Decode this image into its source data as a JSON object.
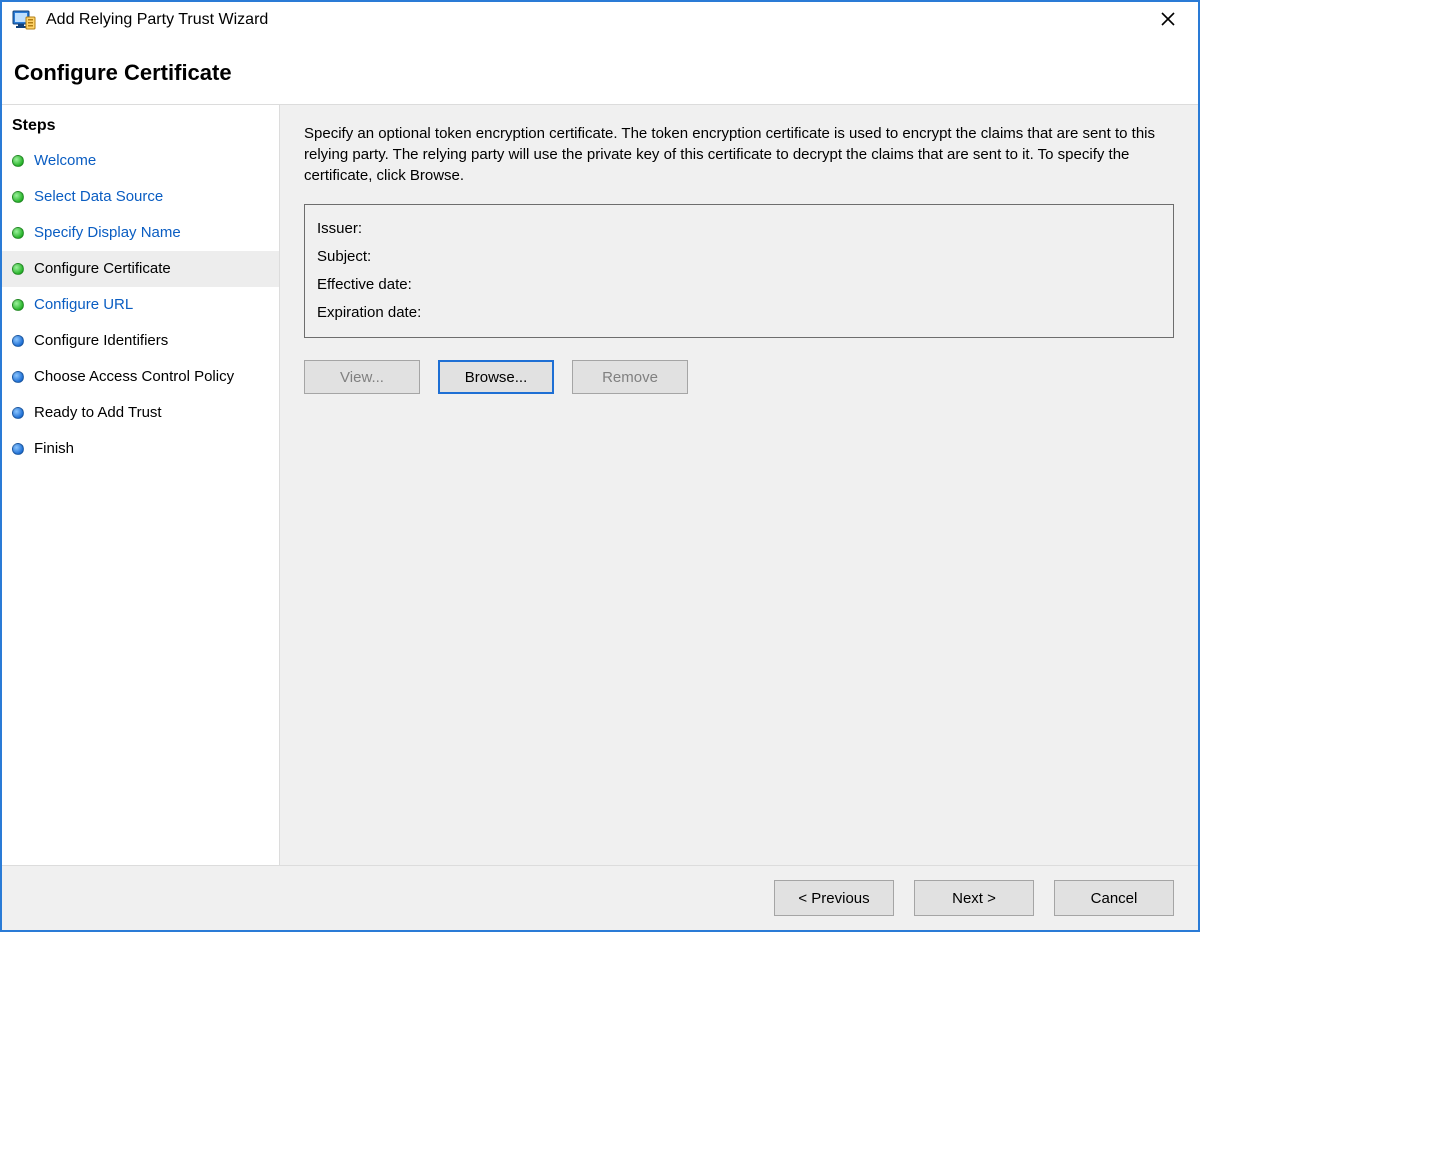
{
  "window": {
    "title": "Add Relying Party Trust Wizard"
  },
  "page": {
    "heading": "Configure Certificate"
  },
  "sidebar": {
    "header": "Steps",
    "items": [
      {
        "label": "Welcome",
        "status": "done",
        "style": "link"
      },
      {
        "label": "Select Data Source",
        "status": "done",
        "style": "link"
      },
      {
        "label": "Specify Display Name",
        "status": "done",
        "style": "link"
      },
      {
        "label": "Configure Certificate",
        "status": "done",
        "style": "current"
      },
      {
        "label": "Configure URL",
        "status": "done",
        "style": "link"
      },
      {
        "label": "Configure Identifiers",
        "status": "pending",
        "style": "plain"
      },
      {
        "label": "Choose Access Control Policy",
        "status": "pending",
        "style": "plain"
      },
      {
        "label": "Ready to Add Trust",
        "status": "pending",
        "style": "plain"
      },
      {
        "label": "Finish",
        "status": "pending",
        "style": "plain"
      }
    ]
  },
  "main": {
    "instructions": "Specify an optional token encryption certificate.  The token encryption certificate is used to encrypt the claims that are sent to this relying party.  The relying party will use the private key of this certificate to decrypt the claims that are sent to it.  To specify the certificate, click Browse.",
    "cert": {
      "issuer_label": "Issuer:",
      "issuer_value": "",
      "subject_label": "Subject:",
      "subject_value": "",
      "effective_label": "Effective date:",
      "effective_value": "",
      "expiration_label": "Expiration date:",
      "expiration_value": ""
    },
    "buttons": {
      "view": "View...",
      "browse": "Browse...",
      "remove": "Remove"
    }
  },
  "footer": {
    "previous": "< Previous",
    "next": "Next >",
    "cancel": "Cancel"
  }
}
